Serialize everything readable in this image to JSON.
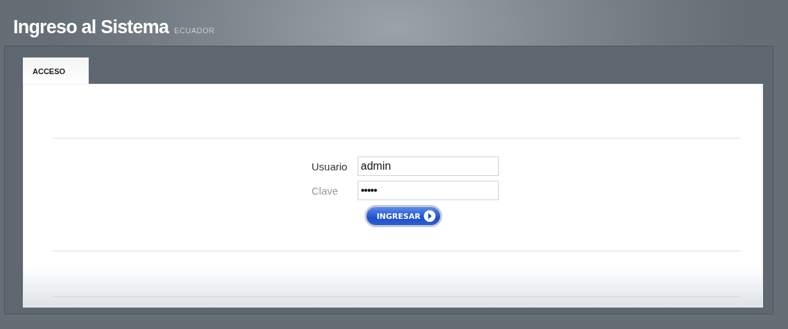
{
  "header": {
    "title": "Ingreso al Sistema",
    "subtitle": "ECUADOR"
  },
  "tabs": [
    {
      "label": "ACCESO",
      "selected": true
    }
  ],
  "form": {
    "fields": [
      {
        "label": "Usuario",
        "value": "admin",
        "kind": "text"
      },
      {
        "label": "Clave",
        "value": "•••••",
        "kind": "password"
      }
    ],
    "button": "INGRESAR"
  }
}
